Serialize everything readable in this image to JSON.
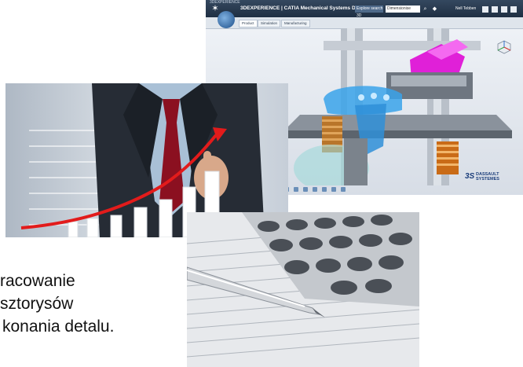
{
  "cad": {
    "app_name": "3DEXPERIENCE",
    "window_title": "3DEXPERIENCE | CATIA Mechanical Systems Design",
    "search_value": "Explore search 3D",
    "search_placeholder": "Dimensionise",
    "user_name": "Nell Tebben",
    "tabs": [
      "Product",
      "Simulation",
      "Manufacturing"
    ],
    "brand_top": "DASSAULT",
    "brand_bottom": "SYSTEMES",
    "brand_logo": "3S"
  },
  "caption": {
    "line1": "racowanie",
    "line2": "sztorysów",
    "line3": "konania detalu."
  },
  "icons": {
    "home": "home-icon",
    "share": "share-icon",
    "compass": "compass-icon",
    "view_cube": "view-cube-icon"
  },
  "colors": {
    "cad_bar": "#1f2f43",
    "part_blue": "#3aa3ea",
    "part_magenta": "#e020d8",
    "spring_orange": "#c96b17",
    "trend_red": "#e21b1b"
  }
}
